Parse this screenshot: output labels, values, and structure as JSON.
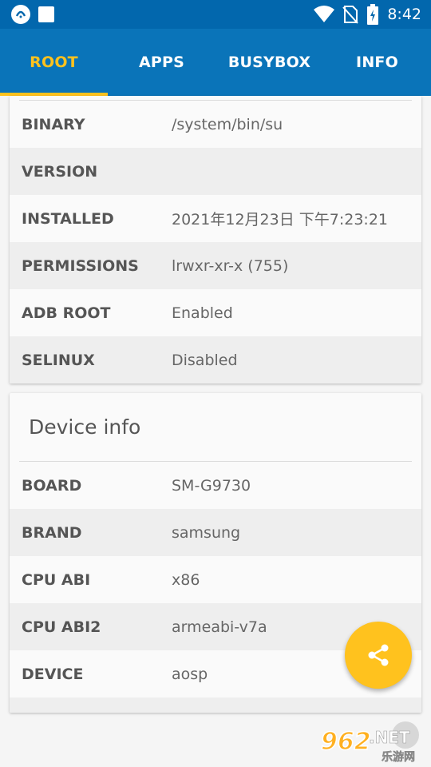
{
  "status_bar": {
    "time": "8:42",
    "icons": [
      "app-icon",
      "square-icon",
      "wifi-icon",
      "no-sim-icon",
      "battery-icon"
    ]
  },
  "tabs": [
    {
      "label": "ROOT",
      "active": true
    },
    {
      "label": "APPS",
      "active": false
    },
    {
      "label": "BUSYBOX",
      "active": false
    },
    {
      "label": "INFO",
      "active": false
    }
  ],
  "colors": {
    "tab_bar": "#0a74b9",
    "status_bar": "#0267ad",
    "accent": "#ffc21e"
  },
  "root_info": {
    "rows": [
      {
        "label": "BINARY",
        "value": "/system/bin/su"
      },
      {
        "label": "VERSION",
        "value": ""
      },
      {
        "label": "INSTALLED",
        "value": "2021年12月23日 下午7:23:21"
      },
      {
        "label": "PERMISSIONS",
        "value": "lrwxr-xr-x (755)"
      },
      {
        "label": "ADB ROOT",
        "value": "Enabled"
      },
      {
        "label": "SELINUX",
        "value": "Disabled"
      }
    ]
  },
  "device_info": {
    "title": "Device info",
    "rows": [
      {
        "label": "BOARD",
        "value": "SM-G9730"
      },
      {
        "label": "BRAND",
        "value": "samsung"
      },
      {
        "label": "CPU ABI",
        "value": "x86"
      },
      {
        "label": "CPU ABI2",
        "value": "armeabi-v7a"
      },
      {
        "label": "DEVICE",
        "value": "aosp"
      }
    ]
  },
  "fab": {
    "icon": "share-icon"
  },
  "watermark": {
    "text_main": "962",
    "text_net": ".NET",
    "text_sub": "乐游网"
  }
}
